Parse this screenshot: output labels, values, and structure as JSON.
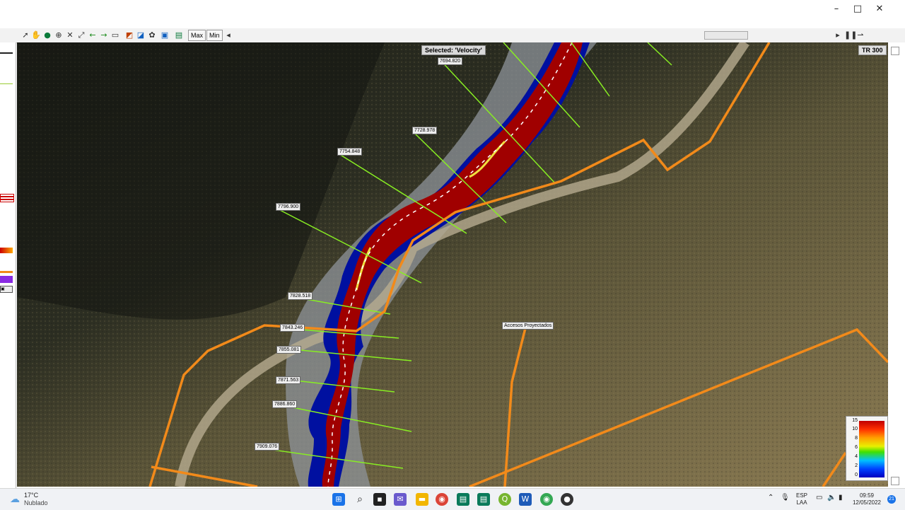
{
  "window": {
    "minimize": "–",
    "maximize": "□",
    "close": "✕"
  },
  "toolbar": {
    "max_label": "Max",
    "min_label": "Min"
  },
  "map": {
    "selected_label": "Selected: 'Velocity'",
    "profile_label": "TR 300",
    "access_label": "Accesos Proyectados",
    "cross_sections": [
      "7694.820",
      "7728.978",
      "7754.848",
      "7796.900",
      "7828.518",
      "7843.246",
      "7855.081",
      "7871.563",
      "7886.860",
      "7909.076"
    ]
  },
  "legend": {
    "ticks": [
      "15",
      "10",
      "8",
      "6",
      "4",
      "2",
      "0"
    ]
  },
  "taskbar": {
    "temperature": "17°C",
    "weather": "Nublado",
    "language": "ESP",
    "layout": "LAA",
    "time": "09:59",
    "date": "12/05/2022",
    "notifications": "21"
  },
  "colors": {
    "river": "#a00000",
    "river_edge": "#0010a0",
    "road_line": "#f28a1a",
    "xs_line": "#88ee22"
  }
}
